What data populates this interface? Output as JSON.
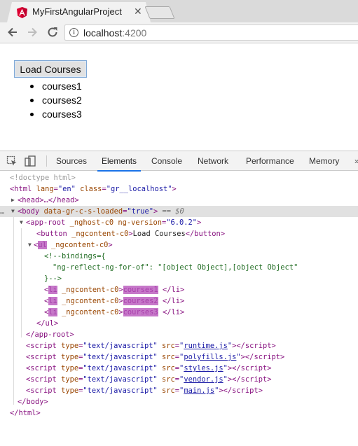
{
  "browser": {
    "tab_title": "MyFirstAngularProject",
    "url_host": "localhost",
    "url_port": ":4200",
    "colors": {
      "favicon_red": "#dd0031",
      "link_blue": "#1a73e8"
    }
  },
  "page": {
    "load_button": "Load Courses",
    "courses": [
      "courses1",
      "courses2",
      "courses3"
    ]
  },
  "devtools": {
    "tabs": [
      "Sources",
      "Elements",
      "Console",
      "Network",
      "Performance",
      "Memory"
    ],
    "active_tab": "Elements",
    "more": "»",
    "icons": [
      "inspect-icon",
      "device-toggle-icon"
    ],
    "dom": {
      "doctype": "<!doctype html>",
      "html_open": "html",
      "html_attr": "lang",
      "html_attr_val": "\"en\"",
      "html_attr2": "class",
      "html_attr2_val": "\"gr__localhost\"",
      "head": "<head>…</head>",
      "body_tag": "body",
      "body_attr": "data-gr-c-s-loaded",
      "body_attr_val": "\"true\"",
      "body_suffix": " == $0",
      "app_root_tag": "app-root",
      "app_root_attr1": "_nghost-c0",
      "app_root_attr2": "ng-version",
      "app_root_attr2_val": "\"6.0.2\"",
      "button_tag": "button",
      "button_attr": "_ngcontent-c0",
      "button_text": "Load Courses",
      "ul_tag": "ul",
      "ul_attr": "_ngcontent-c0",
      "comment_1": "<!--bindings={",
      "comment_2": "\"ng-reflect-ng-for-of\": \"[object Object],[object Object\"",
      "comment_3": "}-->",
      "li_tag": "li",
      "li_attr": "_ngcontent-c0",
      "li_texts": [
        "courses1",
        "courses2",
        "courses3"
      ],
      "ul_close": "</ul>",
      "app_root_close": "</app-root>",
      "scripts": [
        "runtime.js",
        "polyfills.js",
        "styles.js",
        "vendor.js",
        "main.js"
      ],
      "script_tag": "script",
      "script_attr_type": "type",
      "script_attr_type_val": "\"text/javascript\"",
      "script_attr_src": "src",
      "body_close": "</body>",
      "html_close": "</html>"
    }
  }
}
